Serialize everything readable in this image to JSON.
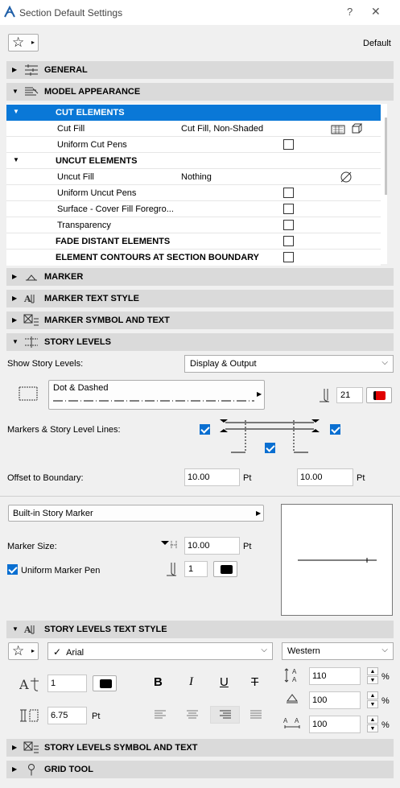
{
  "window": {
    "title": "Section Default Settings",
    "help": "?",
    "close": "✕"
  },
  "favorites": {
    "star": "☆",
    "arrow": "▸",
    "default_label": "Default"
  },
  "sections": {
    "general": "GENERAL",
    "model_appearance": "MODEL APPEARANCE",
    "marker": "MARKER",
    "marker_text_style": "MARKER TEXT STYLE",
    "marker_symbol_text": "MARKER SYMBOL AND TEXT",
    "story_levels": "STORY LEVELS",
    "story_levels_text_style": "STORY LEVELS TEXT STYLE",
    "story_levels_symbol_text": "STORY LEVELS SYMBOL AND TEXT",
    "grid_tool": "GRID TOOL"
  },
  "model_appearance": {
    "cut_elements": "CUT ELEMENTS",
    "cut_fill_label": "Cut Fill",
    "cut_fill_value": "Cut Fill, Non-Shaded",
    "uniform_cut_pens": "Uniform Cut Pens",
    "uncut_elements": "UNCUT ELEMENTS",
    "uncut_fill_label": "Uncut Fill",
    "uncut_fill_value": "Nothing",
    "uniform_uncut_pens": "Uniform Uncut Pens",
    "surface_label": "Surface - Cover Fill Foregro...",
    "transparency": "Transparency",
    "fade_distant": "FADE DISTANT ELEMENTS",
    "element_contours": "ELEMENT CONTOURS AT SECTION BOUNDARY"
  },
  "story_levels": {
    "show_label": "Show Story Levels:",
    "show_value": "Display & Output",
    "line_type": "Dot & Dashed",
    "pen_number": "21",
    "pen_color": "#e00000",
    "markers_label": "Markers & Story Level Lines:",
    "offset_label": "Offset to Boundary:",
    "offset_left": "10.00",
    "offset_right": "10.00",
    "unit_pt": "Pt",
    "marker_type": "Built-in Story Marker",
    "marker_size_label": "Marker Size:",
    "marker_size": "10.00",
    "uniform_marker_pen": "Uniform Marker Pen",
    "marker_pen": "1"
  },
  "text_style": {
    "font": "Arial",
    "script": "Western",
    "pen": "1",
    "size": "6.75",
    "unit_pt": "Pt",
    "bold": "B",
    "italic": "I",
    "underline": "U",
    "strike": "T",
    "line_spacing": "110",
    "width_factor": "100",
    "char_spacing": "100",
    "percent": "%"
  }
}
